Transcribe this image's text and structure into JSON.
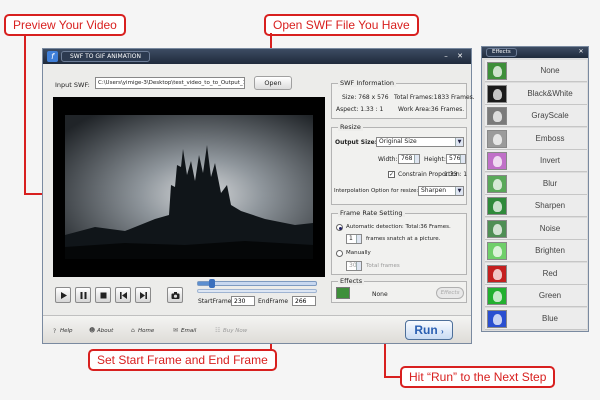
{
  "callouts": {
    "preview": "Preview Your Video",
    "open": "Open SWF File You Have",
    "frames": "Set Start Frame and End Frame",
    "run": "Hit “Run” to the Next Step"
  },
  "window": {
    "title": "SWF TO GIF ANIMATION",
    "input_label": "Input SWF:",
    "input_path": "C:\\Users\\yimige-3\\Desktop\\test_video_to_to_Output_1",
    "open_label": "Open"
  },
  "swf_info": {
    "title": "SWF Information",
    "size": "Size: 768 x 576",
    "total_frames": "Total Frames:1833 Frames.",
    "aspect": "Aspect: 1.33 : 1",
    "work_area": "Work Area:36 Frames."
  },
  "resize": {
    "title": "Resize",
    "output_size_label": "Output Size:",
    "output_size_value": "Original Size",
    "width_label": "Width:",
    "width_value": "768",
    "height_label": "Height:",
    "height_value": "576",
    "constrain_label": "Constrain Proportion",
    "constrain_ratio": "1.33 : 1",
    "interp_label": "Interpolation Option for resize:",
    "interp_value": "Sharpen"
  },
  "frame_rate": {
    "title": "Frame Rate Setting",
    "auto_label": "Automatic detection: Total:36 Frames.",
    "auto_value": "1",
    "auto_suffix": "frames snatch at a picture.",
    "manual_label": "Manually",
    "manual_value": "30",
    "manual_suffix": "Total frames"
  },
  "effects_box": {
    "title": "Effects",
    "value": "None",
    "button": "Effects"
  },
  "frames": {
    "start_label": "StartFrame",
    "start_value": "230",
    "end_label": "EndFrame",
    "end_value": "266",
    "slider_fraction": 0.12
  },
  "bottom": {
    "help": "Help",
    "about": "About",
    "home": "Home",
    "email": "Email",
    "buy": "Buy Now",
    "run": "Run"
  },
  "effects_panel": {
    "title": "Effects",
    "items": [
      {
        "label": "None",
        "color": "#3e8f3a"
      },
      {
        "label": "Black&White",
        "color": "#1a1a1a"
      },
      {
        "label": "GrayScale",
        "color": "#7a7a7a"
      },
      {
        "label": "Emboss",
        "color": "#9b9b9b"
      },
      {
        "label": "Invert",
        "color": "#c070c8"
      },
      {
        "label": "Blur",
        "color": "#5aa85a"
      },
      {
        "label": "Sharpen",
        "color": "#2f8a3b"
      },
      {
        "label": "Noise",
        "color": "#4f8f55"
      },
      {
        "label": "Brighten",
        "color": "#6fcf6a"
      },
      {
        "label": "Red",
        "color": "#c42020"
      },
      {
        "label": "Green",
        "color": "#22b030"
      },
      {
        "label": "Blue",
        "color": "#2a4fd0"
      }
    ]
  },
  "colors": {
    "accent_red": "#d8201f",
    "run_blue": "#2a5fb2"
  }
}
